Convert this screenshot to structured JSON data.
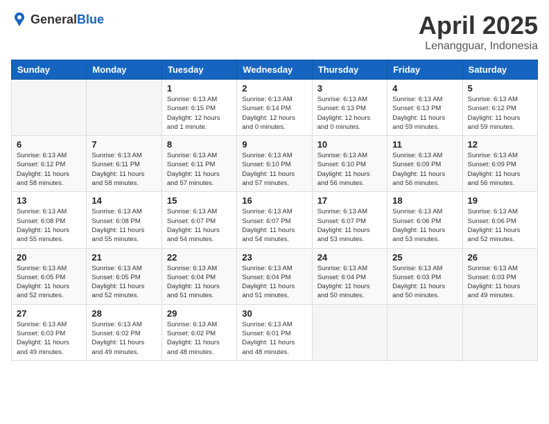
{
  "header": {
    "logo_general": "General",
    "logo_blue": "Blue",
    "month_year": "April 2025",
    "location": "Lenangguar, Indonesia"
  },
  "calendar": {
    "days_of_week": [
      "Sunday",
      "Monday",
      "Tuesday",
      "Wednesday",
      "Thursday",
      "Friday",
      "Saturday"
    ],
    "weeks": [
      [
        {
          "day": "",
          "info": ""
        },
        {
          "day": "",
          "info": ""
        },
        {
          "day": "1",
          "info": "Sunrise: 6:13 AM\nSunset: 6:15 PM\nDaylight: 12 hours\nand 1 minute."
        },
        {
          "day": "2",
          "info": "Sunrise: 6:13 AM\nSunset: 6:14 PM\nDaylight: 12 hours\nand 0 minutes."
        },
        {
          "day": "3",
          "info": "Sunrise: 6:13 AM\nSunset: 6:13 PM\nDaylight: 12 hours\nand 0 minutes."
        },
        {
          "day": "4",
          "info": "Sunrise: 6:13 AM\nSunset: 6:13 PM\nDaylight: 11 hours\nand 59 minutes."
        },
        {
          "day": "5",
          "info": "Sunrise: 6:13 AM\nSunset: 6:12 PM\nDaylight: 11 hours\nand 59 minutes."
        }
      ],
      [
        {
          "day": "6",
          "info": "Sunrise: 6:13 AM\nSunset: 6:12 PM\nDaylight: 11 hours\nand 58 minutes."
        },
        {
          "day": "7",
          "info": "Sunrise: 6:13 AM\nSunset: 6:11 PM\nDaylight: 11 hours\nand 58 minutes."
        },
        {
          "day": "8",
          "info": "Sunrise: 6:13 AM\nSunset: 6:11 PM\nDaylight: 11 hours\nand 57 minutes."
        },
        {
          "day": "9",
          "info": "Sunrise: 6:13 AM\nSunset: 6:10 PM\nDaylight: 11 hours\nand 57 minutes."
        },
        {
          "day": "10",
          "info": "Sunrise: 6:13 AM\nSunset: 6:10 PM\nDaylight: 11 hours\nand 56 minutes."
        },
        {
          "day": "11",
          "info": "Sunrise: 6:13 AM\nSunset: 6:09 PM\nDaylight: 11 hours\nand 56 minutes."
        },
        {
          "day": "12",
          "info": "Sunrise: 6:13 AM\nSunset: 6:09 PM\nDaylight: 11 hours\nand 56 minutes."
        }
      ],
      [
        {
          "day": "13",
          "info": "Sunrise: 6:13 AM\nSunset: 6:08 PM\nDaylight: 11 hours\nand 55 minutes."
        },
        {
          "day": "14",
          "info": "Sunrise: 6:13 AM\nSunset: 6:08 PM\nDaylight: 11 hours\nand 55 minutes."
        },
        {
          "day": "15",
          "info": "Sunrise: 6:13 AM\nSunset: 6:07 PM\nDaylight: 11 hours\nand 54 minutes."
        },
        {
          "day": "16",
          "info": "Sunrise: 6:13 AM\nSunset: 6:07 PM\nDaylight: 11 hours\nand 54 minutes."
        },
        {
          "day": "17",
          "info": "Sunrise: 6:13 AM\nSunset: 6:07 PM\nDaylight: 11 hours\nand 53 minutes."
        },
        {
          "day": "18",
          "info": "Sunrise: 6:13 AM\nSunset: 6:06 PM\nDaylight: 11 hours\nand 53 minutes."
        },
        {
          "day": "19",
          "info": "Sunrise: 6:13 AM\nSunset: 6:06 PM\nDaylight: 11 hours\nand 52 minutes."
        }
      ],
      [
        {
          "day": "20",
          "info": "Sunrise: 6:13 AM\nSunset: 6:05 PM\nDaylight: 11 hours\nand 52 minutes."
        },
        {
          "day": "21",
          "info": "Sunrise: 6:13 AM\nSunset: 6:05 PM\nDaylight: 11 hours\nand 52 minutes."
        },
        {
          "day": "22",
          "info": "Sunrise: 6:13 AM\nSunset: 6:04 PM\nDaylight: 11 hours\nand 51 minutes."
        },
        {
          "day": "23",
          "info": "Sunrise: 6:13 AM\nSunset: 6:04 PM\nDaylight: 11 hours\nand 51 minutes."
        },
        {
          "day": "24",
          "info": "Sunrise: 6:13 AM\nSunset: 6:04 PM\nDaylight: 11 hours\nand 50 minutes."
        },
        {
          "day": "25",
          "info": "Sunrise: 6:13 AM\nSunset: 6:03 PM\nDaylight: 11 hours\nand 50 minutes."
        },
        {
          "day": "26",
          "info": "Sunrise: 6:13 AM\nSunset: 6:03 PM\nDaylight: 11 hours\nand 49 minutes."
        }
      ],
      [
        {
          "day": "27",
          "info": "Sunrise: 6:13 AM\nSunset: 6:03 PM\nDaylight: 11 hours\nand 49 minutes."
        },
        {
          "day": "28",
          "info": "Sunrise: 6:13 AM\nSunset: 6:02 PM\nDaylight: 11 hours\nand 49 minutes."
        },
        {
          "day": "29",
          "info": "Sunrise: 6:13 AM\nSunset: 6:02 PM\nDaylight: 11 hours\nand 48 minutes."
        },
        {
          "day": "30",
          "info": "Sunrise: 6:13 AM\nSunset: 6:01 PM\nDaylight: 11 hours\nand 48 minutes."
        },
        {
          "day": "",
          "info": ""
        },
        {
          "day": "",
          "info": ""
        },
        {
          "day": "",
          "info": ""
        }
      ]
    ]
  }
}
